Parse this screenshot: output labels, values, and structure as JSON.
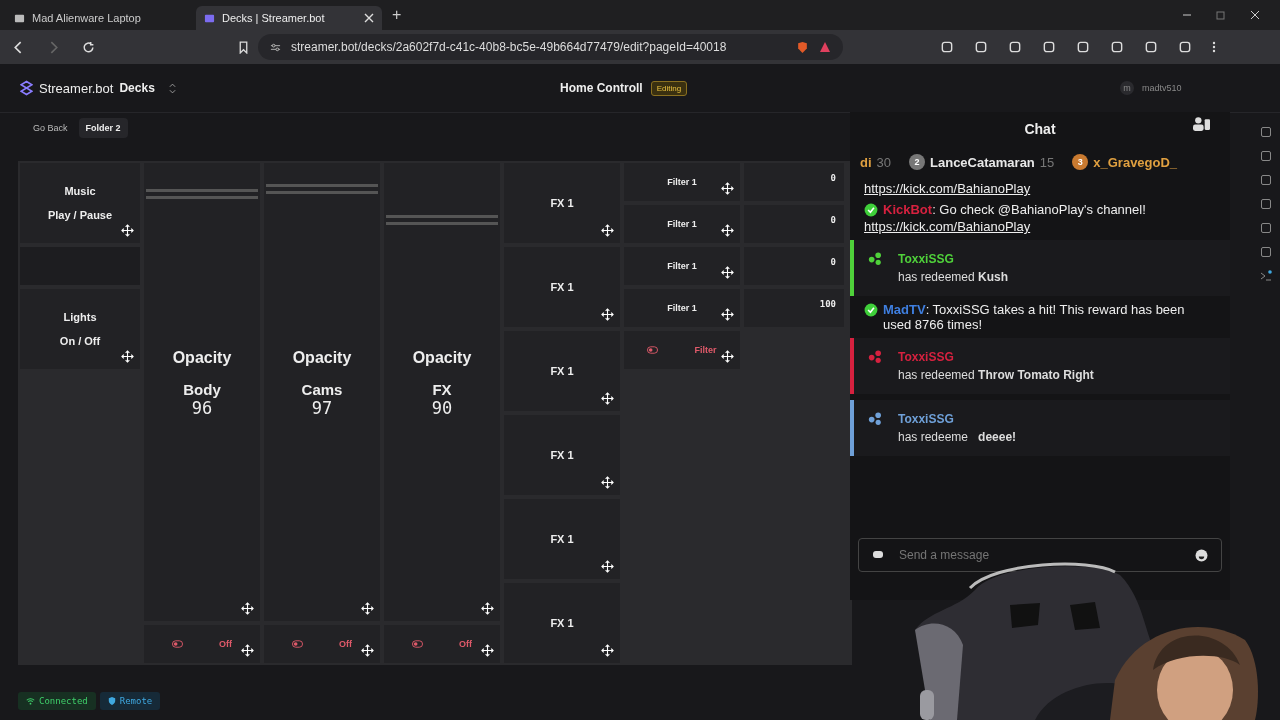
{
  "browser": {
    "tabs": [
      {
        "label": "Mad Alienware Laptop",
        "selected": false
      },
      {
        "label": "Decks | Streamer.bot",
        "selected": true
      }
    ],
    "new_tab": "+",
    "url": "streamer.bot/decks/2a602f7d-c41c-40b8-bc5e-49b664d77479/edit?pageId=40018"
  },
  "header": {
    "brand": "Streamer.bot",
    "section": "Decks",
    "title": "Home Controll",
    "badge": "Editing",
    "avatar": "m",
    "user": "madtv510"
  },
  "subbar": {
    "back": "Go Back",
    "folder": "Folder 2"
  },
  "deck": {
    "columns": [
      [
        {
          "kind": "button",
          "lines": [
            "Music",
            "Play / Pause"
          ]
        },
        {
          "kind": "empty"
        },
        {
          "kind": "button",
          "lines": [
            "Lights",
            "On / Off"
          ]
        }
      ],
      [
        {
          "kind": "slider",
          "title": "Opacity",
          "name": "Body",
          "value": "96",
          "level": 0.96
        },
        {
          "kind": "toggle",
          "label": "Off",
          "on": false
        }
      ],
      [
        {
          "kind": "slider",
          "title": "Opacity",
          "name": "Cams",
          "value": "97",
          "level": 0.97
        },
        {
          "kind": "toggle",
          "label": "Off",
          "on": false
        }
      ],
      [
        {
          "kind": "slider",
          "title": "Opacity",
          "name": "FX",
          "value": "90",
          "level": 0.9
        },
        {
          "kind": "toggle",
          "label": "Off",
          "on": false
        }
      ],
      [
        {
          "kind": "button",
          "lines": [
            "FX 1"
          ]
        },
        {
          "kind": "button",
          "lines": [
            "FX 1"
          ]
        },
        {
          "kind": "button",
          "lines": [
            "FX 1"
          ]
        },
        {
          "kind": "button",
          "lines": [
            "FX 1"
          ]
        },
        {
          "kind": "button",
          "lines": [
            "FX 1"
          ]
        },
        {
          "kind": "button",
          "lines": [
            "FX 1"
          ]
        }
      ],
      [
        {
          "kind": "small",
          "lines": [
            "Filter 1"
          ]
        },
        {
          "kind": "small",
          "lines": [
            "Filter 1"
          ]
        },
        {
          "kind": "small",
          "lines": [
            "Filter 1"
          ]
        },
        {
          "kind": "small",
          "lines": [
            "Filter 1"
          ]
        },
        {
          "kind": "toggle",
          "label": "Filter",
          "on": false
        }
      ],
      [
        {
          "kind": "value",
          "value": "0"
        },
        {
          "kind": "value",
          "value": "0"
        },
        {
          "kind": "value",
          "value": "0"
        },
        {
          "kind": "value",
          "value": "100"
        }
      ]
    ]
  },
  "chat": {
    "title": "Chat",
    "leaders": [
      {
        "name": "di",
        "count": "30",
        "color": "#e0a040"
      },
      {
        "rank": "2",
        "name": "LanceCatamaran",
        "count": "15",
        "color": "#e8e8e8"
      },
      {
        "rank": "3",
        "name": "x_GravegoD_",
        "color": "#e0a040"
      }
    ],
    "messages": [
      {
        "kind": "link",
        "link": "https://kick.com/BahianoPlay"
      },
      {
        "kind": "chat",
        "user": "KickBot",
        "color": "#d6213f",
        "text": ": Go check @BahianoPlay's channel!",
        "link": "https://kick.com/BahianoPlay"
      },
      {
        "kind": "redeem",
        "user": "ToxxiSSG",
        "color": "#4fd13a",
        "text": "has redeemed **Kush**"
      },
      {
        "kind": "chat",
        "user": "MadTV",
        "color": "#3f7fe0",
        "text": ": ToxxiSSG takes a hit! This reward has been used 8766 times!"
      },
      {
        "kind": "redeem",
        "user": "ToxxiSSG",
        "color": "#d6213f",
        "text": "has redeemed **Throw Tomato Right**"
      },
      {
        "kind": "redeem",
        "user": "ToxxiSSG",
        "color": "#6fa0d8",
        "text": "has redeeme",
        "tail": "deeee!"
      }
    ],
    "placeholder": "Send a message"
  },
  "status": [
    {
      "label": "Connected",
      "kind": "connected"
    },
    {
      "label": "Remote",
      "kind": "remote"
    }
  ]
}
